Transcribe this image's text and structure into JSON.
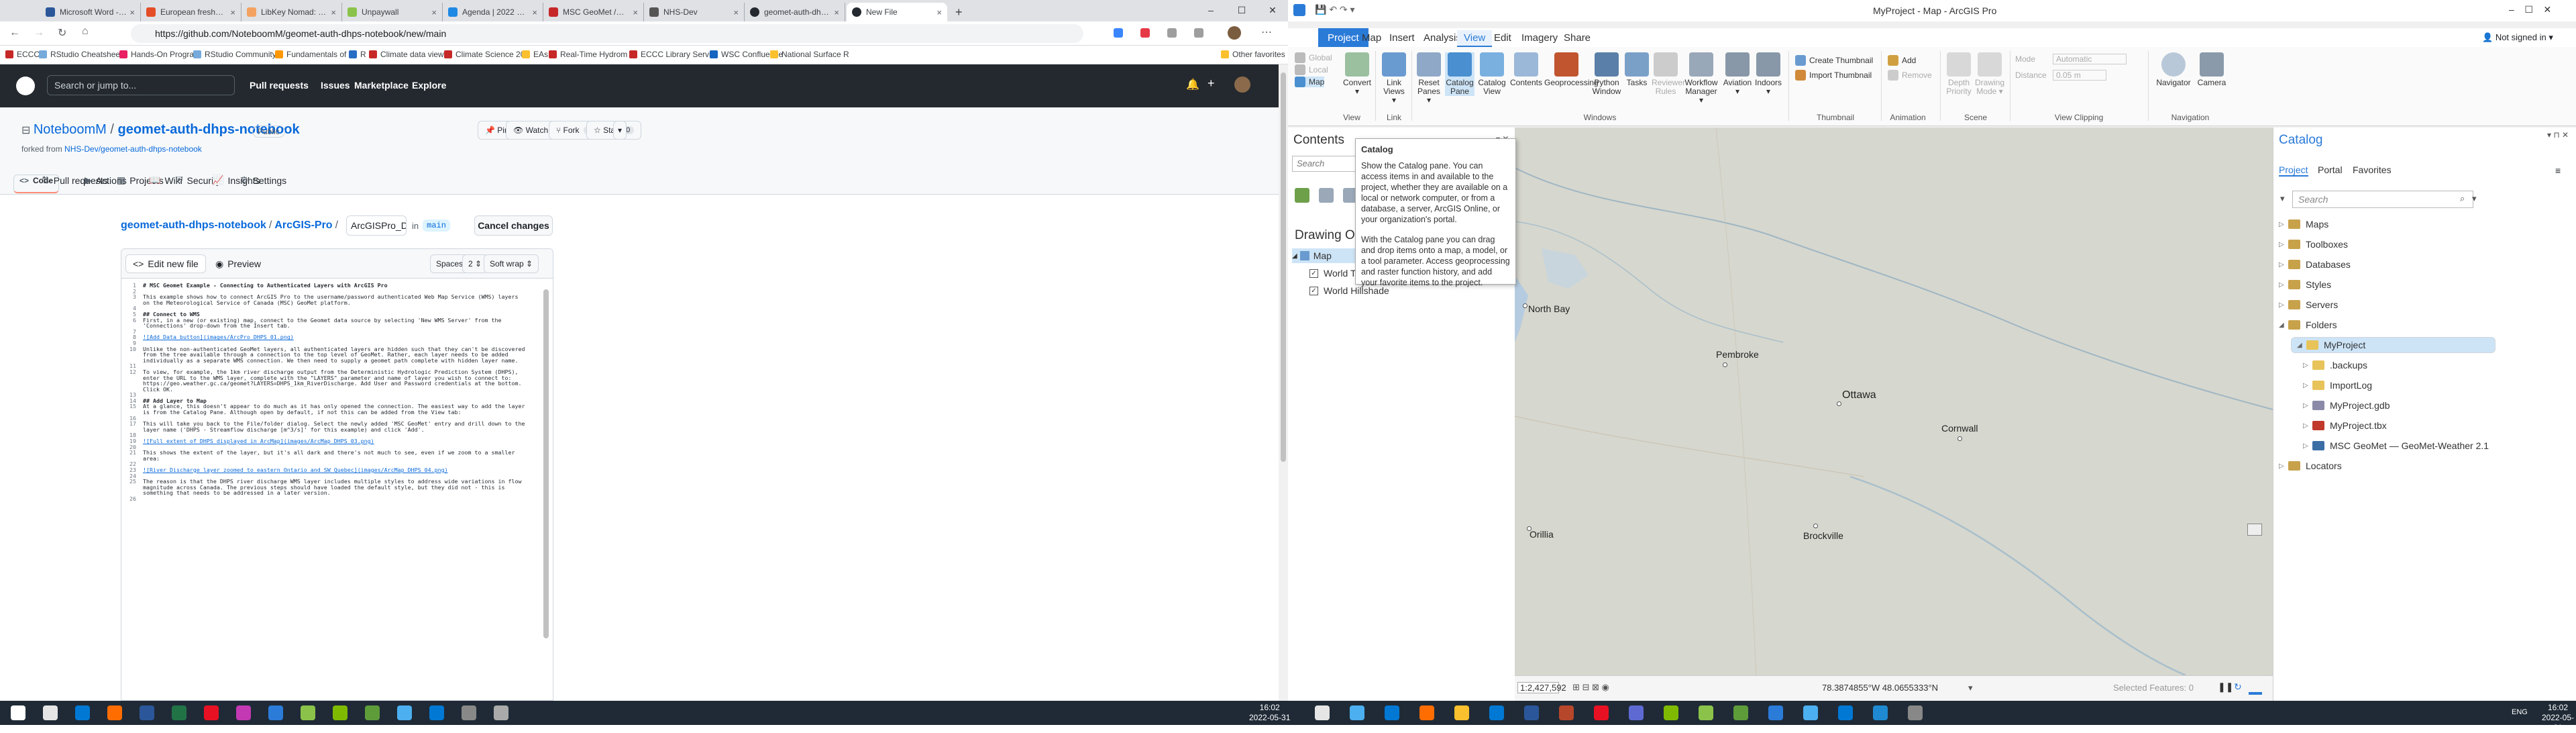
{
  "browser": {
    "tabs": [
      {
        "title": "Microsoft Word - geom",
        "color": "#2b579a"
      },
      {
        "title": "European freshwater",
        "color": "#e44d26"
      },
      {
        "title": "LibKey Nomad: Technol",
        "color": "#f4a261"
      },
      {
        "title": "Unpaywall",
        "color": "#8bc34a"
      },
      {
        "title": "Agenda | 2022 Esri Us",
        "color": "#1e88e5"
      },
      {
        "title": "MSC GeoMet /GeoMet",
        "color": "#c62828"
      },
      {
        "title": "NHS-Dev",
        "color": "#555"
      },
      {
        "title": "geomet-auth-dhps-no",
        "color": "#24292f"
      },
      {
        "title": "New File",
        "color": "#24292f"
      }
    ],
    "new_tab": "+",
    "url": "https://github.com/NoteboomM/geomet-auth-dhps-notebook/new/main",
    "bookmarks": [
      {
        "label": "ECCC",
        "color": "#c62828"
      },
      {
        "label": "RStudio Cheatsheet",
        "color": "#75aadb"
      },
      {
        "label": "Hands-On Program",
        "color": "#e91e63"
      },
      {
        "label": "RStudio Community",
        "color": "#75aadb"
      },
      {
        "label": "Fundamentals of D",
        "color": "#ff9800"
      },
      {
        "label": "R",
        "color": "#276dc3"
      },
      {
        "label": "Climate data viewer",
        "color": "#c62828"
      },
      {
        "label": "Climate Science 20",
        "color": "#c62828"
      },
      {
        "label": "EAs",
        "color": "#fbc02d"
      },
      {
        "label": "Real-Time Hydrom",
        "color": "#c62828"
      },
      {
        "label": "ECCC Library Servic",
        "color": "#c62828"
      },
      {
        "label": "WSC Confluence",
        "color": "#1565c0"
      },
      {
        "label": "National Surface R",
        "color": "#fbc02d"
      },
      {
        "label": "Other favorites",
        "color": "#fbc02d"
      }
    ]
  },
  "github": {
    "search_placeholder": "Search or jump to...",
    "nav": [
      "Pull requests",
      "Issues",
      "Marketplace",
      "Explore"
    ],
    "owner": "NoteboomM",
    "repo": "geomet-auth-dhps-notebook",
    "visibility": "Public",
    "forked_prefix": "forked from",
    "forked_from": "NHS-Dev/geomet-auth-dhps-notebook",
    "actions": [
      {
        "label": "Pin",
        "count": ""
      },
      {
        "label": "Watch",
        "count": "0"
      },
      {
        "label": "Fork",
        "count": "1"
      },
      {
        "label": "Star",
        "count": "0"
      }
    ],
    "repo_tabs": [
      "Code",
      "Pull requests",
      "Actions",
      "Projects",
      "Wiki",
      "Security",
      "Insights",
      "Settings"
    ],
    "breadcrumb": {
      "repo": "geomet-auth-dhps-notebook",
      "folder": "ArcGIS-Pro",
      "filename": "ArcGISPro_DHPS_tutorial.md",
      "in": "in",
      "branch": "main"
    },
    "cancel": "Cancel changes",
    "editor": {
      "tab_edit": "Edit new file",
      "tab_preview": "Preview",
      "indent_mode": "Spaces",
      "indent_size": "2",
      "wrap_mode": "Soft wrap"
    },
    "code_lines": [
      {
        "n": "1",
        "t": "# MSC Geomet Example - Connecting to Authenticated Layers with ArcGIS Pro",
        "k": "h"
      },
      {
        "n": "2",
        "t": "",
        "k": ""
      },
      {
        "n": "3",
        "t": "This example shows how to connect ArcGIS Pro to the username/password authenticated Web Map Service (WMS) layers on the Meteorological Service of Canada (MSC) GeoMet platform.",
        "k": ""
      },
      {
        "n": "4",
        "t": "",
        "k": ""
      },
      {
        "n": "5",
        "t": "## Connect to WMS",
        "k": "h"
      },
      {
        "n": "6",
        "t": "First, in a new (or existing) map, connect to the Geomet data source by selecting 'New WMS Server' from the 'Connections' drop-down from the Insert tab.",
        "k": ""
      },
      {
        "n": "7",
        "t": "",
        "k": ""
      },
      {
        "n": "8",
        "t": "![Add Data button](images/ArcPro_DHPS_01.png)",
        "k": "l"
      },
      {
        "n": "9",
        "t": "",
        "k": ""
      },
      {
        "n": "10",
        "t": "Unlike the non-authenticated GeoMet layers, all authenticated layers are hidden such that they can't be discovered from the tree available through a connection to the top level of GeoMet. Rather, each layer needs to be added individually as a separate WMS connection. We then need to supply a geomet path complete with hidden layer name.",
        "k": ""
      },
      {
        "n": "11",
        "t": "",
        "k": ""
      },
      {
        "n": "12",
        "t": "To view, for example, the 1km river discharge output from the Deterministic Hydrologic Prediction System (DHPS), enter the URL to the WMS layer, complete with the \"LAYERS\" parameter and name of layer you wish to connect to: https://geo.weather.gc.ca/geomet?LAYERS=DHPS_1km_RiverDischarge. Add User and Password credentials at the bottom. Click OK.",
        "k": ""
      },
      {
        "n": "13",
        "t": "",
        "k": ""
      },
      {
        "n": "14",
        "t": "## Add Layer to Map",
        "k": "h"
      },
      {
        "n": "15",
        "t": "At a glance, this doesn't appear to do much as it has only opened the connection. The easiest way to add the layer is from the Catalog Pane. Although open by default, if not this can be added from the View tab:",
        "k": ""
      },
      {
        "n": "16",
        "t": "",
        "k": ""
      },
      {
        "n": "17",
        "t": "This will take you back to the File/folder dialog. Select the newly added 'MSC GeoMet' entry and drill down to the layer name ('DHPS - Streamflow discharge [m^3/s]' for this example) and click 'Add'.",
        "k": ""
      },
      {
        "n": "18",
        "t": "",
        "k": ""
      },
      {
        "n": "19",
        "t": "![Full extent of DHPS displayed in ArcMap](images/ArcMap_DHPS_03.png)",
        "k": "l"
      },
      {
        "n": "20",
        "t": "",
        "k": ""
      },
      {
        "n": "21",
        "t": "This shows the extent of the layer, but it's all dark and there's not much to see, even if we zoom to a smaller area:",
        "k": ""
      },
      {
        "n": "22",
        "t": "",
        "k": ""
      },
      {
        "n": "23",
        "t": "![River Discharge layer zoomed to eastern Ontario and SW Quebec](images/ArcMap_DHPS_04.png)",
        "k": "l"
      },
      {
        "n": "24",
        "t": "",
        "k": ""
      },
      {
        "n": "25",
        "t": "The reason is that the DHPS river discharge WMS layer includes multiple styles to address wide variations in flow magnitude across Canada. The previous steps should have loaded the default style, but they did not - this is something that needs to be addressed in a later version.",
        "k": ""
      },
      {
        "n": "26",
        "t": "",
        "k": ""
      }
    ]
  },
  "arcgis": {
    "title": "MyProject - Map - ArcGIS Pro",
    "signin": "Not signed in",
    "ribbon_tabs": [
      "Project",
      "Map",
      "Insert",
      "Analysis",
      "View",
      "Edit",
      "Imagery",
      "Share"
    ],
    "active_tab": "View",
    "view_group": {
      "small": [
        "Global",
        "Local",
        "Map"
      ],
      "large": "Convert",
      "label": "View"
    },
    "link_group": {
      "button": "Link Views",
      "label": "Link"
    },
    "windows_group": {
      "buttons": [
        "Reset Panes",
        "Catalog Pane",
        "Catalog View",
        "Contents",
        "Geoprocessing",
        "Python Window",
        "Tasks",
        "Reviewer Rules",
        "Workflow Manager",
        "Aviation",
        "Indoors"
      ],
      "label": "Windows"
    },
    "thumbnail_group": {
      "buttons": [
        "Create Thumbnail",
        "Import Thumbnail"
      ],
      "label": "Thumbnail"
    },
    "animation_group": {
      "buttons": [
        "Add",
        "Remove"
      ],
      "label": "Animation"
    },
    "scene_group": {
      "buttons": [
        "Depth Priority",
        "Drawing Mode"
      ],
      "label": "Scene"
    },
    "clipping_group": {
      "mode_label": "Mode",
      "mode_value": "Automatic",
      "distance_label": "Distance",
      "distance_value": "0.05 m",
      "label": "View Clipping"
    },
    "navigation_group": {
      "buttons": [
        "Navigator",
        "Camera"
      ],
      "label": "Navigation"
    },
    "contents": {
      "title": "Contents",
      "search_placeholder": "Search",
      "drawing_order": "Drawing Order",
      "map": "Map",
      "layers": [
        "World Topographic Map",
        "World Hillshade"
      ]
    },
    "tooltip": {
      "title": "Catalog",
      "p1": "Show the Catalog pane. You can access items in and available to the project, whether they are available on a local or network computer, or from a database, a server, ArcGIS Online, or your organization's portal.",
      "p2": "With the Catalog pane you can drag and drop items onto a map, a model, or a tool parameter. Access geoprocessing and raster function history, and add your favorite items to the project."
    },
    "map": {
      "cities": [
        "North Bay",
        "Pembroke",
        "Ottawa",
        "Cornwall",
        "Orillia",
        "Brockville"
      ],
      "scale": "1:2,427,592",
      "coords": "78.3874855°W 48.0655333°N",
      "selected": "Selected Features: 0"
    },
    "catalog": {
      "title": "Catalog",
      "tabs": [
        "Project",
        "Portal",
        "Favorites"
      ],
      "search_placeholder": "Search",
      "items": [
        {
          "label": "Maps",
          "color": "#c8a24a"
        },
        {
          "label": "Toolboxes",
          "color": "#c8a24a"
        },
        {
          "label": "Databases",
          "color": "#c8a24a"
        },
        {
          "label": "Styles",
          "color": "#c8a24a"
        },
        {
          "label": "Servers",
          "color": "#c8a24a"
        },
        {
          "label": "Folders",
          "color": "#c8a24a"
        },
        {
          "label": "MyProject",
          "color": "#e8c35a"
        },
        {
          "label": ".backups",
          "color": "#e8c35a"
        },
        {
          "label": "ImportLog",
          "color": "#e8c35a"
        },
        {
          "label": "MyProject.gdb",
          "color": "#8a8aa8"
        },
        {
          "label": "MyProject.tbx",
          "color": "#c0392b"
        },
        {
          "label": "MSC GeoMet — GeoMet-Weather 2.1",
          "color": "#3b6ea5"
        },
        {
          "label": "Locators",
          "color": "#c8a24a"
        }
      ]
    }
  },
  "taskbar": {
    "clock_left": {
      "time": "16:02",
      "date": "2022-05-31"
    },
    "clock_right": {
      "time": "16:02",
      "date": "2022-05-31"
    },
    "lang": "ENG"
  }
}
